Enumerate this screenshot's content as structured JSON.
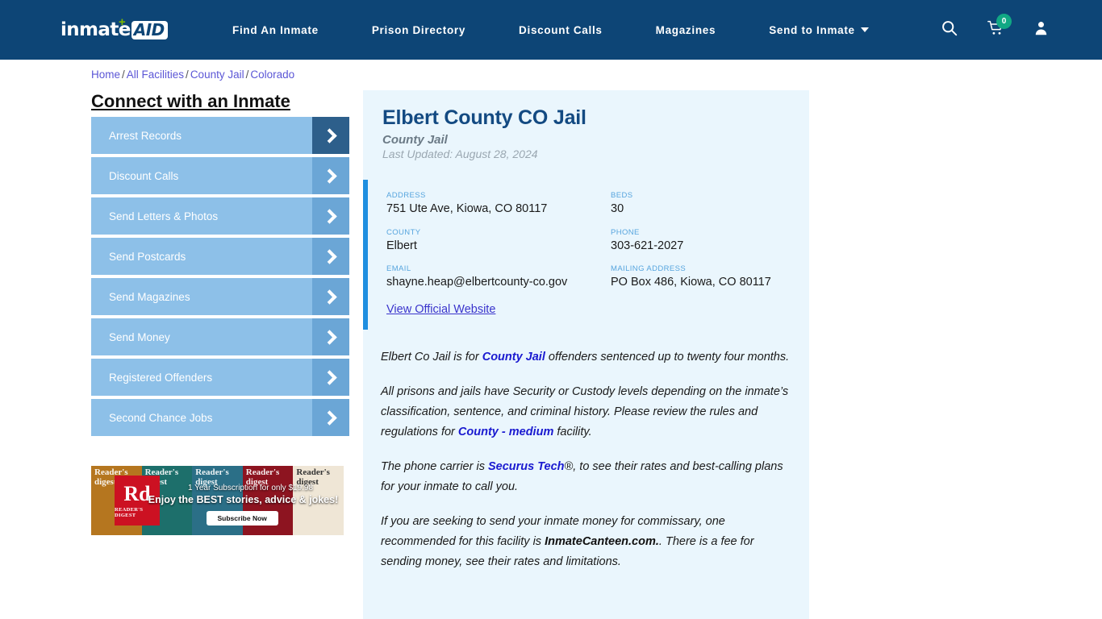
{
  "header": {
    "logo": {
      "text": "inmate",
      "badge": "AID",
      "plus": "+"
    },
    "nav": [
      {
        "label": "Find An Inmate",
        "caret": false
      },
      {
        "label": "Prison Directory",
        "caret": false
      },
      {
        "label": "Discount Calls",
        "caret": false
      },
      {
        "label": "Magazines",
        "caret": false
      },
      {
        "label": "Send to Inmate",
        "caret": true
      }
    ],
    "icons": {
      "search": "search-icon",
      "cart": "cart-icon",
      "account": "user-icon"
    },
    "cart_count": "0",
    "accent_color": "#0d4576",
    "badge_color": "#11a884"
  },
  "breadcrumb": {
    "items": [
      "Home",
      "All Facilities",
      "County Jail",
      "Colorado"
    ],
    "separator": "/"
  },
  "sidebar": {
    "title": "Connect with an Inmate",
    "items": [
      {
        "label": "Arrest Records",
        "active": true
      },
      {
        "label": "Discount Calls",
        "active": false
      },
      {
        "label": "Send Letters & Photos",
        "active": false
      },
      {
        "label": "Send Postcards",
        "active": false
      },
      {
        "label": "Send Magazines",
        "active": false
      },
      {
        "label": "Send Money",
        "active": false
      },
      {
        "label": "Registered Offenders",
        "active": false
      },
      {
        "label": "Second Chance Jobs",
        "active": false
      }
    ]
  },
  "ad": {
    "brand": "Rd",
    "brand_sub": "READER'S DIGEST",
    "line1": "1 Year Subscription for only $19.98",
    "line2": "Enjoy the BEST stories, advice & jokes!",
    "button": "Subscribe Now",
    "covers": [
      "Reader's digest",
      "Reader's digest",
      "Reader's digest",
      "Reader's digest",
      "Reader's digest"
    ]
  },
  "facility": {
    "name": "Elbert County CO Jail",
    "type": "County Jail",
    "updated": "Last Updated: August 28, 2024",
    "fields": [
      {
        "label": "ADDRESS",
        "value": "751 Ute Ave, Kiowa, CO 80117"
      },
      {
        "label": "BEDS",
        "value": "30"
      },
      {
        "label": "COUNTY",
        "value": "Elbert"
      },
      {
        "label": "PHONE",
        "value": "303-621-2027"
      },
      {
        "label": "EMAIL",
        "value": "shayne.heap@elbertcounty-co.gov"
      },
      {
        "label": "MAILING ADDRESS",
        "value": "PO Box 486, Kiowa, CO 80117"
      }
    ],
    "website_link": "View Official Website"
  },
  "body": {
    "p1_a": "Elbert Co Jail is for ",
    "p1_hl": "County Jail",
    "p1_b": " offenders sentenced up to twenty four months.",
    "p2_a": "All prisons and jails have Security or Custody levels depending on the inmate’s classification, sentence, and criminal history. Please review the rules and regulations for ",
    "p2_hl": "County - medium",
    "p2_b": " facility.",
    "p3_a": "The phone carrier is ",
    "p3_hl": "Securus Tech",
    "p3_reg": "®",
    "p3_b": ", to see their rates and best-calling plans for your inmate to call you.",
    "p4_a": "If you are seeking to send your inmate money for commissary, one recommended for this facility is ",
    "p4_hl": "InmateCanteen.com.",
    "p4_b": ". There is a fee for sending money, see their rates and limitations."
  }
}
